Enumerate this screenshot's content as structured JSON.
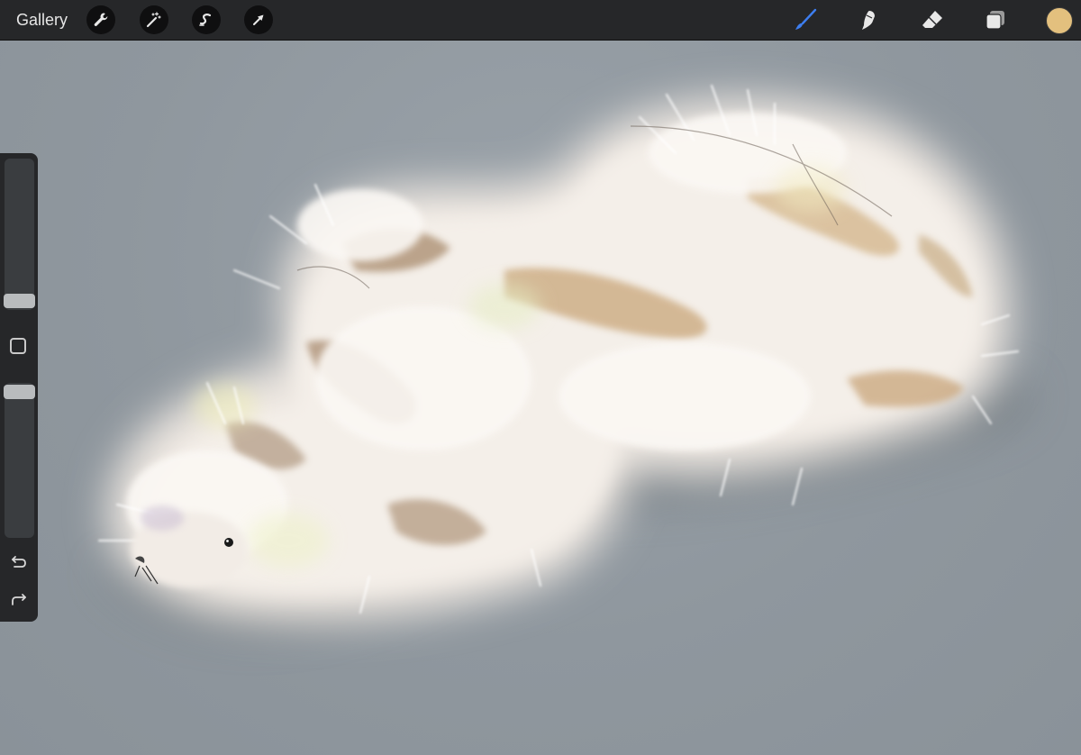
{
  "toolbar": {
    "gallery_label": "Gallery",
    "left_tools": [
      "wrench-icon",
      "magic-wand-icon",
      "selection-icon",
      "transform-arrow-icon"
    ],
    "right_tools": [
      "brush-icon",
      "smudge-icon",
      "eraser-icon",
      "layers-icon"
    ],
    "active_tool": "brush-icon",
    "accent_color": "#3d7ef0",
    "current_color": "#e3c07e"
  },
  "sidebar": {
    "brush_size_level": 0.1,
    "opacity_level": 0.98,
    "buttons": [
      "modify-button",
      "undo-icon",
      "redo-icon"
    ]
  },
  "canvas": {
    "background_color": "#8f979e",
    "subject": "white-fluffy-creature-painting"
  }
}
